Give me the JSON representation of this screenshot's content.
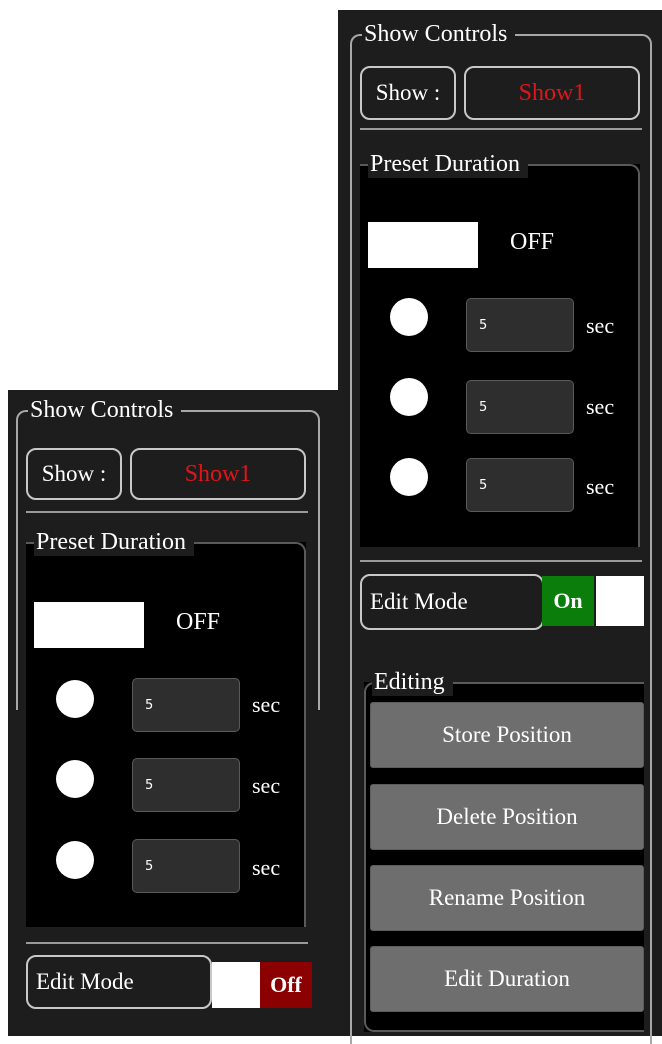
{
  "left_panel": {
    "show_controls": {
      "title": "Show Controls",
      "show_label": "Show :",
      "show_value": "Show1"
    },
    "preset_duration": {
      "title": "Preset Duration",
      "toggle_state": "OFF",
      "presets": [
        {
          "value": "5",
          "unit": "sec"
        },
        {
          "value": "5",
          "unit": "sec"
        },
        {
          "value": "5",
          "unit": "sec"
        }
      ]
    },
    "edit_mode": {
      "label": "Edit Mode",
      "toggle_label": "Off",
      "toggle_color": "#8b0000"
    }
  },
  "right_panel": {
    "show_controls": {
      "title": "Show Controls",
      "show_label": "Show :",
      "show_value": "Show1"
    },
    "preset_duration": {
      "title": "Preset Duration",
      "toggle_state": "OFF",
      "presets": [
        {
          "value": "5",
          "unit": "sec"
        },
        {
          "value": "5",
          "unit": "sec"
        },
        {
          "value": "5",
          "unit": "sec"
        }
      ]
    },
    "edit_mode": {
      "label": "Edit Mode",
      "toggle_label": "On",
      "toggle_color": "#0b7d0b"
    },
    "editing": {
      "title": "Editing",
      "buttons": [
        "Store Position",
        "Delete Position",
        "Rename Position",
        "Edit Duration"
      ]
    }
  },
  "colors": {
    "panel_bg": "#1d1d1d",
    "show_value": "#e0151b",
    "button_bg": "#6e6e6e"
  }
}
